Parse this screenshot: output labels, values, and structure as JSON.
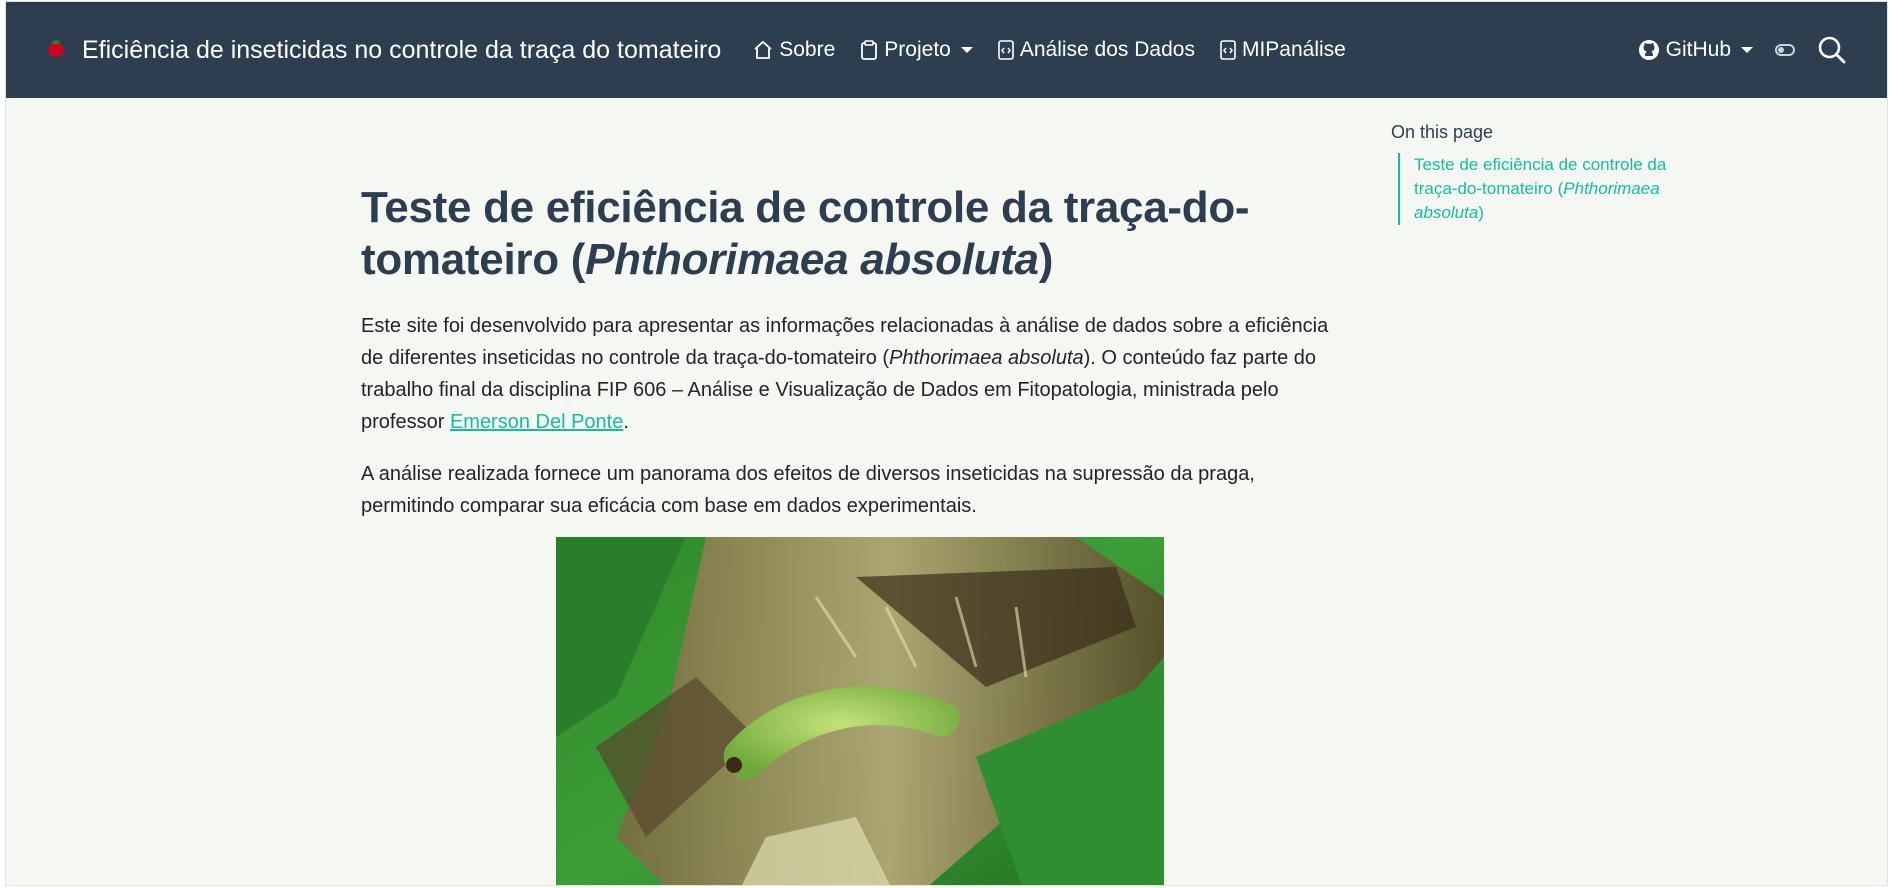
{
  "header": {
    "site_title": "Eficiência de inseticidas no controle da traça do tomateiro",
    "nav": [
      {
        "label": "Sobre",
        "icon": "home-icon"
      },
      {
        "label": "Projeto",
        "icon": "clipboard-icon",
        "dropdown": true
      },
      {
        "label": "Análise dos Dados",
        "icon": "code-file-icon"
      },
      {
        "label": "MIPanálise",
        "icon": "code-file-icon"
      }
    ],
    "github_label": "GitHub"
  },
  "content": {
    "title_plain": "Teste de eficiência de controle da traça-do-tomateiro (",
    "title_italic": "Phthorimaea absoluta",
    "title_close": ")",
    "p1_a": "Este site foi desenvolvido para apresentar as informações relacionadas à análise de dados sobre a eficiência de diferentes inseticidas no controle da traça-do-tomateiro (",
    "p1_italic": "Phthorimaea absoluta",
    "p1_b": "). O conteúdo faz parte do trabalho final da disciplina FIP 606 – Análise e Visualização de Dados em Fitopatologia, ministrada pelo professor ",
    "p1_link": "Emerson Del Ponte",
    "p1_end": ".",
    "p2": "A análise realizada fornece um panorama dos efeitos de diversos inseticidas na supressão da praga, permitindo comparar sua eficácia com base em dados experimentais."
  },
  "toc": {
    "title": "On this page",
    "item_plain": "Teste de eficiência de controle da traça-do-tomateiro (",
    "item_italic": "Phthorimaea absoluta",
    "item_close": ")"
  },
  "colors": {
    "navbar": "#2c3e50",
    "accent": "#18bc9c",
    "background": "#f4f7f2"
  }
}
